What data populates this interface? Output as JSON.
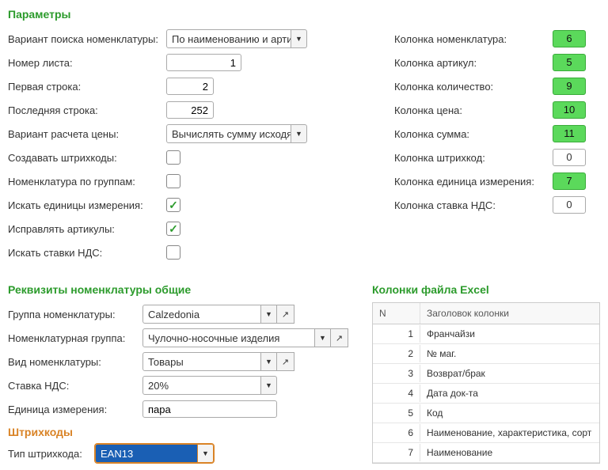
{
  "params_title": "Параметры",
  "left": {
    "search_variant_label": "Вариант поиска номенклатуры:",
    "search_variant_value": "По наименованию и артикулу",
    "sheet_label": "Номер листа:",
    "sheet_value": "1",
    "first_row_label": "Первая строка:",
    "first_row_value": "2",
    "last_row_label": "Последняя строка:",
    "last_row_value": "252",
    "price_calc_label": "Вариант расчета цены:",
    "price_calc_value": "Вычислять сумму исходя",
    "create_barcodes_label": "Создавать штрихкоды:",
    "groups_label": "Номенклатура по группам:",
    "search_units_label": "Искать единицы измерения:",
    "fix_articles_label": "Исправлять артикулы:",
    "search_vat_label": "Искать ставки НДС:"
  },
  "right": {
    "col_nomen_label": "Колонка номенклатура:",
    "col_nomen_val": "6",
    "col_article_label": "Колонка артикул:",
    "col_article_val": "5",
    "col_qty_label": "Колонка количество:",
    "col_qty_val": "9",
    "col_price_label": "Колонка цена:",
    "col_price_val": "10",
    "col_sum_label": "Колонка сумма:",
    "col_sum_val": "11",
    "col_barcode_label": "Колонка штрихкод:",
    "col_barcode_val": "0",
    "col_unit_label": "Колонка единица измерения:",
    "col_unit_val": "7",
    "col_vat_label": "Колонка ставка НДС:",
    "col_vat_val": "0"
  },
  "requisites_title": "Реквизиты номенклатуры общие",
  "req": {
    "group_label": "Группа номенклатуры:",
    "group_value": "Calzedonia",
    "nomgroup_label": "Номенклатурная группа:",
    "nomgroup_value": "Чулочно-носочные изделия",
    "type_label": "Вид номенклатуры:",
    "type_value": "Товары",
    "vat_label": "Ставка НДС:",
    "vat_value": "20%",
    "unit_label": "Единица измерения:",
    "unit_value": "пара"
  },
  "barcodes_title": "Штрихкоды",
  "barcode_type_label": "Тип штрихкода:",
  "barcode_type_value": "EAN13",
  "excel_title": "Колонки файла Excel",
  "table": {
    "header_n": "N",
    "header_col": "Заголовок колонки",
    "rows": [
      {
        "n": "1",
        "title": "Франчайзи"
      },
      {
        "n": "2",
        "title": "№ маг."
      },
      {
        "n": "3",
        "title": "Возврат/брак"
      },
      {
        "n": "4",
        "title": "Дата док-та"
      },
      {
        "n": "5",
        "title": "Код"
      },
      {
        "n": "6",
        "title": "Наименование, характеристика, сорт"
      },
      {
        "n": "7",
        "title": "Наименование"
      }
    ]
  }
}
